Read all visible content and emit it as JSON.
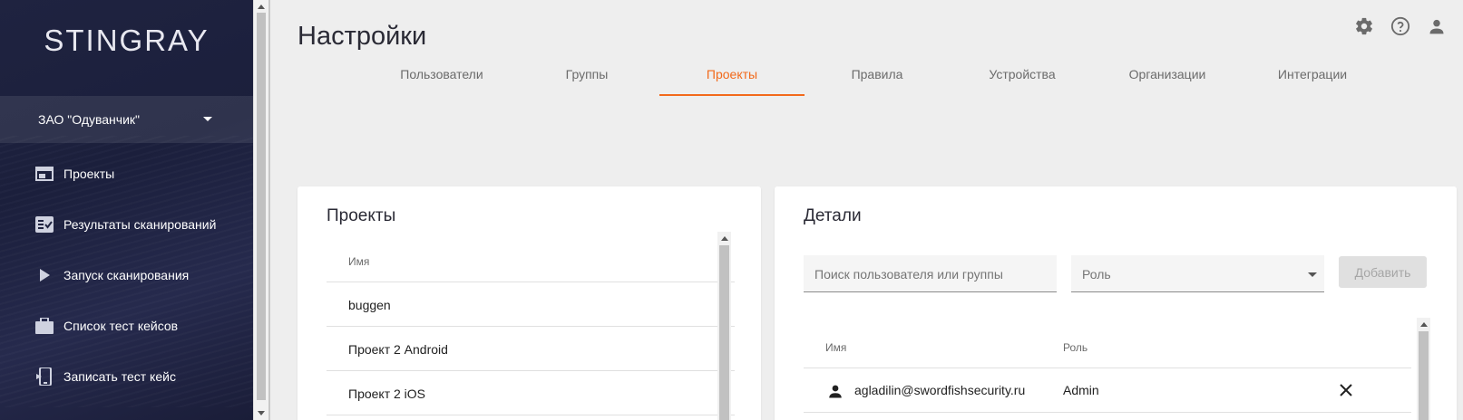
{
  "sidebar": {
    "logo": "STINGRAY",
    "org": "ЗАО \"Одуванчик\"",
    "items": [
      {
        "label": "Проекты",
        "icon": "projects-icon"
      },
      {
        "label": "Результаты сканирований",
        "icon": "scan-results-icon"
      },
      {
        "label": "Запуск сканирования",
        "icon": "play-icon"
      },
      {
        "label": "Список тест кейсов",
        "icon": "briefcase-icon"
      },
      {
        "label": "Записать тест кейс",
        "icon": "record-test-icon"
      }
    ]
  },
  "header": {
    "title": "Настройки",
    "icons": [
      "gear-icon",
      "help-icon",
      "user-icon"
    ]
  },
  "tabs": [
    {
      "label": "Пользователи",
      "active": false
    },
    {
      "label": "Группы",
      "active": false
    },
    {
      "label": "Проекты",
      "active": true
    },
    {
      "label": "Правила",
      "active": false
    },
    {
      "label": "Устройства",
      "active": false
    },
    {
      "label": "Организации",
      "active": false
    },
    {
      "label": "Интеграции",
      "active": false
    }
  ],
  "projects_card": {
    "title": "Проекты",
    "column_header": "Имя",
    "rows": [
      "buggen",
      "Проект 2 Android",
      "Проект 2 iOS"
    ]
  },
  "details_card": {
    "title": "Детали",
    "search_placeholder": "Поиск пользователя или группы",
    "role_placeholder": "Роль",
    "add_label": "Добавить",
    "columns": {
      "name": "Имя",
      "role": "Роль"
    },
    "users": [
      {
        "email": "agladilin@swordfishsecurity.ru",
        "role": "Admin"
      }
    ]
  },
  "colors": {
    "accent": "#f26a1b",
    "sidebar_bg": "#1f2340",
    "page_bg": "#eeeeee"
  }
}
